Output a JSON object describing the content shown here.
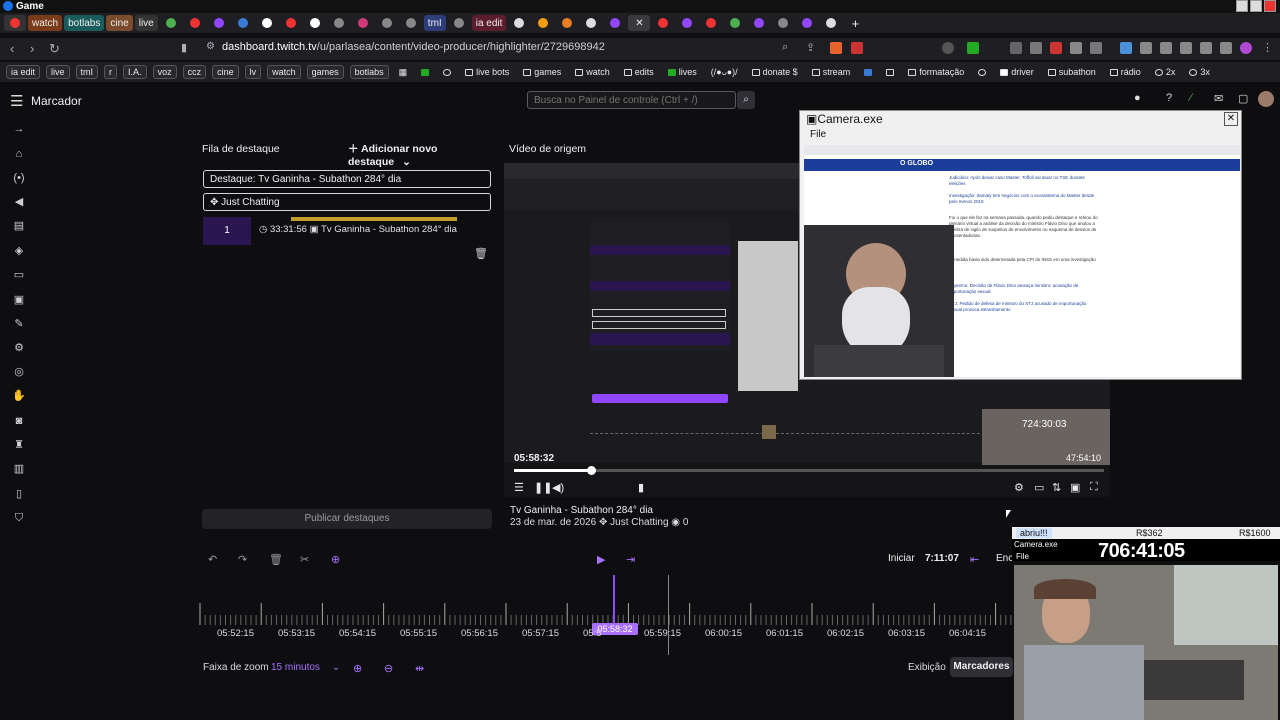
{
  "os": {
    "title": "Game"
  },
  "browser": {
    "tabs": [
      {
        "label": "",
        "color": "#e33"
      },
      {
        "label": "watch",
        "color": "#b83"
      },
      {
        "label": "botlabs",
        "color": "#2aa"
      },
      {
        "label": "cine",
        "color": "#c74"
      },
      {
        "label": "live",
        "color": "#444"
      },
      {
        "label": "tmI",
        "color": "#46c"
      },
      {
        "label": "ia edit",
        "color": "#a34"
      }
    ],
    "url_host": "dashboard.twitch.tv",
    "url_path": "/u/parlasea/content/video-producer/highlighter/2729698942",
    "bookmarks": [
      {
        "label": "ia edit",
        "pill": true
      },
      {
        "label": "live",
        "pill": true
      },
      {
        "label": "tmI",
        "pill": true
      },
      {
        "label": "r",
        "pill": true
      },
      {
        "label": "I.A.",
        "pill": true
      },
      {
        "label": "voz",
        "pill": true
      },
      {
        "label": "ccz",
        "pill": true
      },
      {
        "label": "cine",
        "pill": true
      },
      {
        "label": "lv",
        "pill": true
      },
      {
        "label": "watch",
        "pill": true
      },
      {
        "label": "games",
        "pill": true
      },
      {
        "label": "botlabs",
        "pill": true
      },
      {
        "label": "live bots",
        "pill": false
      },
      {
        "label": "games",
        "pill": false
      },
      {
        "label": "watch",
        "pill": false
      },
      {
        "label": "edits",
        "pill": false
      },
      {
        "label": "lives",
        "pill": false
      },
      {
        "label": "(/●ᴗ●)/",
        "pill": false
      },
      {
        "label": "donate $",
        "pill": false
      },
      {
        "label": "stream",
        "pill": false
      },
      {
        "label": "formatação",
        "pill": false
      },
      {
        "label": "driver",
        "pill": false
      },
      {
        "label": "subathon",
        "pill": false
      },
      {
        "label": "rádio",
        "pill": false
      },
      {
        "label": "2x",
        "pill": false
      },
      {
        "label": "3x",
        "pill": false
      }
    ]
  },
  "header": {
    "page_title": "Marcador",
    "search_placeholder": "Busca no Painel de controle (Ctrl + /)"
  },
  "queue": {
    "title": "Fila de destaque",
    "add_button": "Adicionar novo destaque",
    "highlight_title": "Destaque: Tv Ganinha - Subathon 284° dia",
    "category": "Just Chatting",
    "item": {
      "number": "1",
      "time": "33:31:56",
      "title": "Tv Ganinha - Subathon 284° dia"
    },
    "publish_label": "Publicar destaques"
  },
  "video": {
    "label": "Vídeo de origem",
    "current_time": "05:58:32",
    "progress": 0.13,
    "stream_title": "Tv Ganinha - Subathon 284° dia",
    "date": "23 de mar. de 2026",
    "category": "Just Chatting",
    "viewers": "0",
    "overlay_time_1": "724:30:03",
    "overlay_time_2": "47:54:10"
  },
  "timeline": {
    "start_label": "Iniciar",
    "start_time": "7:11:07",
    "end_label": "Enc",
    "tick_labels": [
      "05:52:15",
      "05:53:15",
      "05:54:15",
      "05:55:15",
      "05:56:15",
      "05:57:15",
      "05:5",
      "05:59:15",
      "06:00:15",
      "06:01:15",
      "06:02:15",
      "06:03:15",
      "06:04:15"
    ],
    "playhead_label": "05:58:32",
    "zoom_label": "Faixa de zoom",
    "zoom_value": "15 minutos",
    "view_label": "Exibição",
    "markers_label": "Marcadores"
  },
  "camera_window": {
    "title": "Camera.exe",
    "menu_file": "File",
    "site_name": "O GLOBO",
    "paragraphs": [
      "Judiciário: Após deixar caso Master, Toffoli vai atuar no TSE durante eleições",
      "Investigação: Itamaty tem negócios com o ecossistema do Master desde pelo menos 2019",
      "Foi o que ele fez na semana passada, quando pediu destaque e retirou do plenário virtual a análise da decisão do ministro Flávio Dino que anulou a quebra de sigilo de suspeitos de envolvimento no esquema de desvios de aposentadorias.",
      "A medida havia sido determinada pela CPI do INSS em uma investigação",
      "Supremo: Decisão de Flávio Dino ameaça ministro: acusação de importunação sexual",
      "STJ: Pedido de defesa de ministro do STJ acusado de importunação sexual provoca estranhamento"
    ]
  },
  "overlay": {
    "left_label": "abriu!!!",
    "mid_label": "R$362",
    "right_label": "R$1600",
    "cam_label": "Camera.exe",
    "file_label": "File",
    "big_time": "706:41:05"
  }
}
